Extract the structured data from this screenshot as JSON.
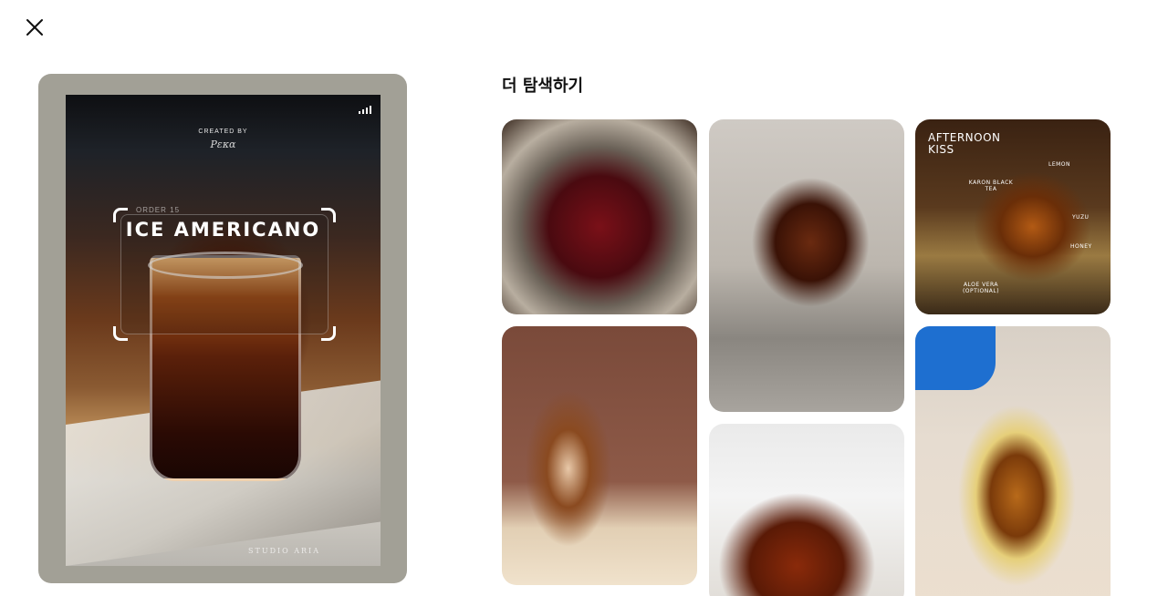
{
  "close_button": {
    "icon": "close-icon"
  },
  "preview": {
    "created_by": "CREATED BY",
    "signature": "Ρεκα",
    "subtitle": "ORDER 15",
    "drink_name": "ICE AMERICANO",
    "footer_credit": "STUDIO ARIA",
    "frame_color": "#a2a096"
  },
  "explore": {
    "title": "더 탐색하기",
    "tiles": [
      {
        "name": "red-cocktail"
      },
      {
        "name": "iced-americano-tray"
      },
      {
        "name": "afternoon-kiss",
        "heading_line1": "AFTERNOON",
        "heading_line2": "KISS",
        "ingredients": [
          "LEMON",
          "KARON BLACK TEA",
          "YUZU",
          "HONEY",
          "ALOE VERA (OPTIONAL)"
        ]
      },
      {
        "name": "iced-latte"
      },
      {
        "name": "iced-brew-glasses"
      },
      {
        "name": "poured-lemon-tea"
      }
    ]
  }
}
